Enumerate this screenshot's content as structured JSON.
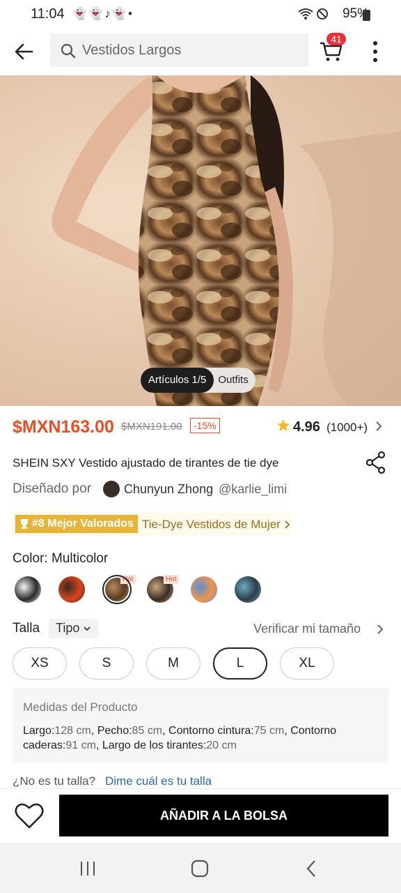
{
  "status_bar": {
    "time": "11:04",
    "notification_icons": [
      "snapchat-icon",
      "snapchat-icon",
      "tiktok-icon",
      "snapchat-icon",
      "dot-icon"
    ],
    "battery": "95%"
  },
  "header": {
    "search_text": "Vestidos Largos",
    "cart_count": "41"
  },
  "gallery": {
    "articles_label": "Artículos 1/5",
    "outfits_label": "Outfits"
  },
  "price": {
    "current": "$MXN163.00",
    "original": "$MXN191.00",
    "discount": "-15%",
    "rating": "4.96",
    "rating_count": "(1000+)"
  },
  "product": {
    "title": "SHEIN SXY Vestido ajustado de tirantes de tie dye",
    "designer_label": "Diseñado por",
    "designer_name": "Chunyun Zhong",
    "designer_handle": "@karlie_limi"
  },
  "rank": {
    "badge": "#8 Mejor Valorados",
    "category": "Tie-Dye Vestidos de Mujer"
  },
  "color": {
    "label": "Color: Multicolor",
    "hot_label": "Hot",
    "swatches": [
      {
        "colors": [
          "#2a2a2a",
          "#f2f2f2"
        ],
        "hot": false
      },
      {
        "colors": [
          "#d9451e",
          "#3a2a20"
        ],
        "hot": false
      },
      {
        "colors": [
          "#5a3a22",
          "#b88b5e"
        ],
        "hot": true,
        "selected": true
      },
      {
        "colors": [
          "#3b2c22",
          "#c9a77e"
        ],
        "hot": true
      },
      {
        "colors": [
          "#f0944a",
          "#5a8fd6"
        ],
        "hot": false
      },
      {
        "colors": [
          "#2e3d46",
          "#6da8c4"
        ],
        "hot": false
      }
    ]
  },
  "size": {
    "label": "Talla",
    "type_label": "Tipo",
    "verify_label": "Verificar mi tamaño",
    "options": [
      "XS",
      "S",
      "M",
      "L",
      "XL"
    ],
    "selected": "L"
  },
  "measures": {
    "title": "Medidas del Producto",
    "largo_label": "Largo:",
    "largo_value": "128 cm",
    "pecho_label": "Pecho:",
    "pecho_value": "85 cm",
    "cintura_label": "Contorno cintura:",
    "cintura_value": "75 cm",
    "caderas_label": "Contorno caderas:",
    "caderas_value": "91 cm",
    "tirantes_label": "Largo de los tirantes:",
    "tirantes_value": "20 cm"
  },
  "fit": {
    "question": "¿No es tu talla?",
    "link": "Dime cuál es tu talla"
  },
  "actions": {
    "add_to_bag": "AÑADIR A LA BOLSA"
  },
  "colors": {
    "accent": "#e94d24",
    "link": "#2a69b3",
    "rank_gold": "#e5b53a"
  }
}
